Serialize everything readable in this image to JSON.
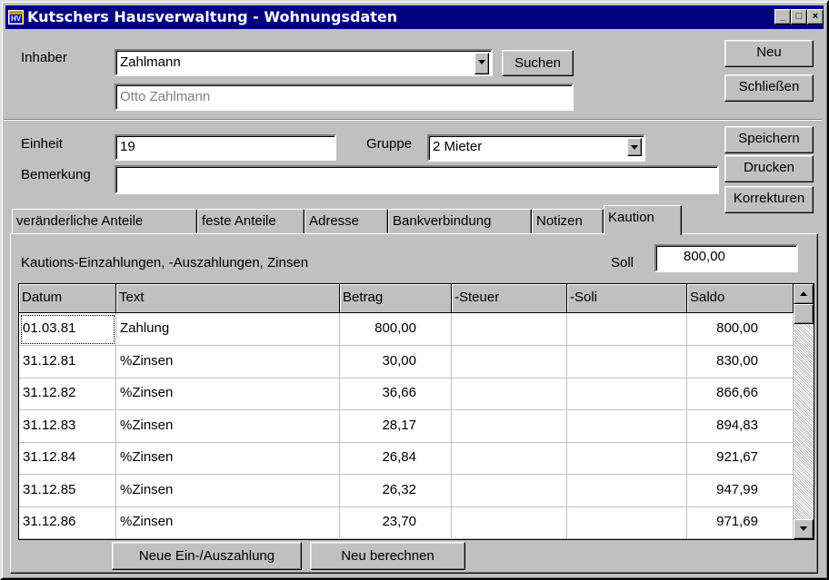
{
  "window": {
    "title": "Kutschers Hausverwaltung - Wohnungsdaten",
    "icon_text": "HV",
    "controls": {
      "minimize": "_",
      "maximize": "□",
      "close": "×"
    }
  },
  "owner": {
    "label": "Inhaber",
    "selected": "Zahlmann",
    "full_name": "Otto Zahlmann",
    "search_label": "Suchen"
  },
  "right_buttons": {
    "new": "Neu",
    "close": "Schließen",
    "save": "Speichern",
    "print": "Drucken",
    "corrections": "Korrekturen"
  },
  "unit": {
    "label": "Einheit",
    "value": "19",
    "group_label": "Gruppe",
    "group_value": "2 Mieter",
    "remark_label": "Bemerkung",
    "remark_value": ""
  },
  "tabs": [
    {
      "label": "veränderliche Anteile"
    },
    {
      "label": "feste Anteile"
    },
    {
      "label": "Adresse"
    },
    {
      "label": "Bankverbindung"
    },
    {
      "label": "Notizen"
    },
    {
      "label": "Kaution",
      "active": true
    }
  ],
  "deposit": {
    "heading": "Kautions-Einzahlungen, -Auszahlungen, Zinsen",
    "soll_label": "Soll",
    "soll_value": "800,00",
    "columns": [
      "Datum",
      "Text",
      "Betrag",
      "-Steuer",
      "-Soli",
      "Saldo"
    ],
    "rows": [
      {
        "date": "01.03.81",
        "text": "Zahlung",
        "amount": "800,00",
        "tax": "",
        "soli": "",
        "balance": "800,00"
      },
      {
        "date": "31.12.81",
        "text": "%Zinsen",
        "amount": "30,00",
        "tax": "",
        "soli": "",
        "balance": "830,00"
      },
      {
        "date": "31.12.82",
        "text": "%Zinsen",
        "amount": "36,66",
        "tax": "",
        "soli": "",
        "balance": "866,66"
      },
      {
        "date": "31.12.83",
        "text": "%Zinsen",
        "amount": "28,17",
        "tax": "",
        "soli": "",
        "balance": "894,83"
      },
      {
        "date": "31.12.84",
        "text": "%Zinsen",
        "amount": "26,84",
        "tax": "",
        "soli": "",
        "balance": "921,67"
      },
      {
        "date": "31.12.85",
        "text": "%Zinsen",
        "amount": "26,32",
        "tax": "",
        "soli": "",
        "balance": "947,99"
      },
      {
        "date": "31.12.86",
        "text": "%Zinsen",
        "amount": "23,70",
        "tax": "",
        "soli": "",
        "balance": "971,69"
      }
    ],
    "new_entry_label": "Neue Ein-/Auszahlung",
    "recalc_label": "Neu berechnen"
  }
}
